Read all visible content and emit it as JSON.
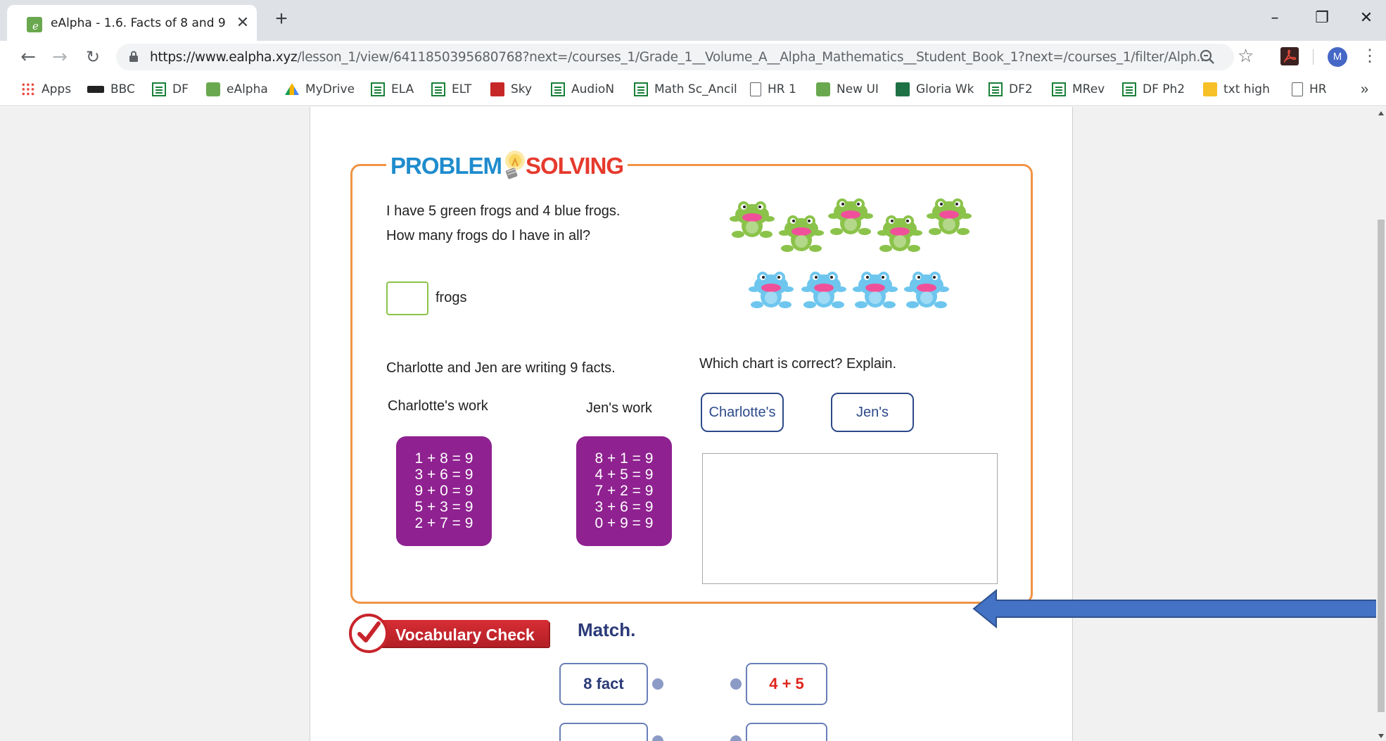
{
  "browser": {
    "tab_title": "eAlpha - 1.6. Facts of 8 and 9",
    "url_host": "https://www.ealpha.xyz",
    "url_path": "/lesson_1/view/6411850395680768?next=/courses_1/Grade_1__Volume_A__Alpha_Mathematics__Student_Book_1?next=/courses_1/filter/Alph...",
    "avatar_letter": "M",
    "bookmarks": [
      {
        "label": "Apps",
        "icon": "apps-grid-icon"
      },
      {
        "label": "BBC",
        "icon": "bbc-icon"
      },
      {
        "label": "DF",
        "icon": "sheets-icon"
      },
      {
        "label": "eAlpha",
        "icon": "ealpha-icon"
      },
      {
        "label": "MyDrive",
        "icon": "drive-icon"
      },
      {
        "label": "ELA",
        "icon": "sheets-icon"
      },
      {
        "label": "ELT",
        "icon": "sheets-icon"
      },
      {
        "label": "Sky",
        "icon": "sky-icon"
      },
      {
        "label": "AudioN",
        "icon": "sheets-icon"
      },
      {
        "label": "Math Sc_Ancil",
        "icon": "sheets-icon"
      },
      {
        "label": "HR 1",
        "icon": "document-icon"
      },
      {
        "label": "New UI",
        "icon": "ealpha-icon"
      },
      {
        "label": "Gloria Wk",
        "icon": "excel-icon"
      },
      {
        "label": "DF2",
        "icon": "sheets-icon"
      },
      {
        "label": "MRev",
        "icon": "sheets-icon"
      },
      {
        "label": "DF Ph2",
        "icon": "sheets-icon"
      },
      {
        "label": "txt high",
        "icon": "keep-note-icon"
      },
      {
        "label": "HR",
        "icon": "document-icon"
      }
    ]
  },
  "problem_solving": {
    "heading_part1": "PROBLEM",
    "heading_part2": "SOLVING",
    "question1_line1": "I have 5 green frogs and 4 blue frogs.",
    "question1_line2": "How many frogs do I have in all?",
    "answer_unit": "frogs",
    "question2": "Charlotte and Jen are writing 9 facts.",
    "charlotte_label": "Charlotte's work",
    "jen_label": "Jen's work",
    "charlotte_facts": [
      "1 + 8 = 9",
      "3 + 6 = 9",
      "9 + 0 = 9",
      "5 + 3 = 9",
      "2 + 7 = 9"
    ],
    "jen_facts": [
      "8 + 1 = 9",
      "4 + 5 = 9",
      "7 + 2 = 9",
      "3 + 6 = 9",
      "0 + 9 = 9"
    ],
    "chart_question": "Which chart is correct? Explain.",
    "choice_charlotte": "Charlotte's",
    "choice_jen": "Jen's",
    "green_frog_count": 5,
    "blue_frog_count": 4,
    "colors": {
      "border": "#f09445",
      "card": "#8f2190",
      "green_frog": "#8bc34a",
      "blue_frog": "#6ec6ee"
    }
  },
  "vocab": {
    "badge": "Vocabulary Check",
    "instruction": "Match.",
    "left_items": [
      "8 fact"
    ],
    "right_items": [
      "4 + 5"
    ]
  }
}
